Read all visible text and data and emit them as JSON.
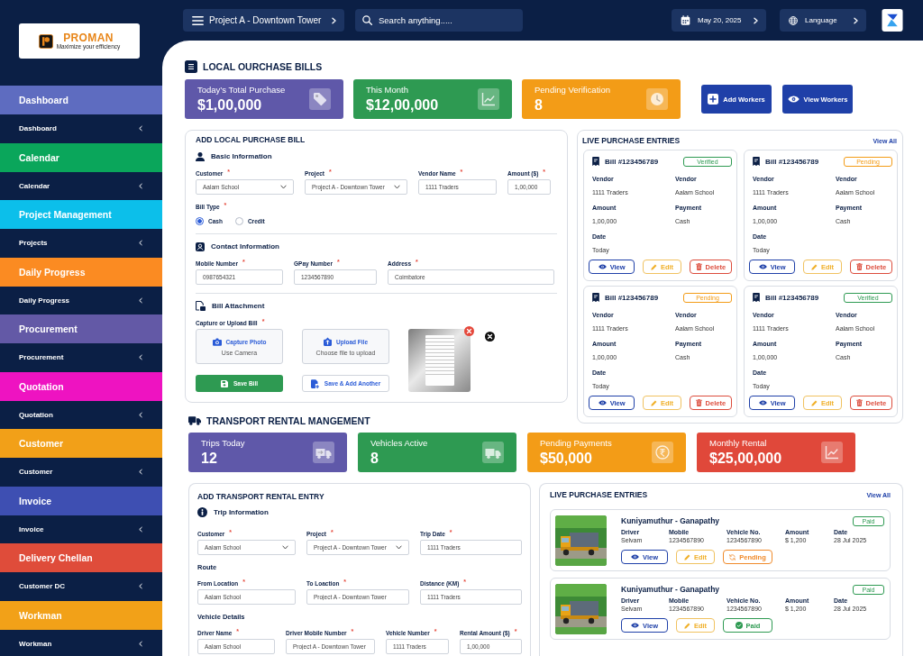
{
  "logo": {
    "name": "PROMAN",
    "tagline": "Maximize your efficiency"
  },
  "topbar": {
    "project": "Project A - Downtown Tower",
    "search": {
      "placeholder": "Search anything....."
    },
    "date": "May 20, 2025",
    "language": "Language"
  },
  "sidebar": {
    "groups": [
      {
        "title": "Dashboard",
        "color": "#5e6cc0",
        "item": "Dashboard"
      },
      {
        "title": "Calendar",
        "color": "#0aa65b",
        "item": "Calendar"
      },
      {
        "title": "Project Management",
        "color": "#0cbfea",
        "item": "Projects"
      },
      {
        "title": "Daily Progress",
        "color": "#fb8b22",
        "item": "Daily Progress"
      },
      {
        "title": "Procurement",
        "color": "#6359a6",
        "item": "Procurement"
      },
      {
        "title": "Quotation",
        "color": "#ee13c1",
        "item": "Quotation"
      },
      {
        "title": "Customer",
        "color": "#f2a018",
        "item": "Customer"
      },
      {
        "title": "Invoice",
        "color": "#3e4fb2",
        "item": "Invoice"
      },
      {
        "title": "Delivery Chellan",
        "color": "#df4c3a",
        "item": "Customer DC"
      },
      {
        "title": "Workman",
        "color": "#f2a118",
        "item": "Workman"
      }
    ]
  },
  "local_purchase": {
    "title": "LOCAL OURCHASE BILLS",
    "stats": [
      {
        "label": "Today’s Total Purchase",
        "value": "$1,00,000",
        "color": "#5f58a9",
        "kind": "tag"
      },
      {
        "label": "This Month",
        "value": "$12,00,000",
        "color": "#2e9a52",
        "kind": "chart"
      },
      {
        "label": "Pending Verification",
        "value": "8",
        "color": "#f39c17",
        "kind": "clock"
      }
    ],
    "actions": [
      {
        "label": "Add Workers",
        "kind": "add"
      },
      {
        "label": "View Workers",
        "kind": "view"
      }
    ],
    "form": {
      "title": "ADD LOCAL PURCHASE BILL",
      "sections": [
        {
          "kind": "basic",
          "title": "Basic Information",
          "fields": [
            {
              "label": "Customer",
              "mark": "*",
              "kind": "select",
              "value": "Aalam School"
            },
            {
              "label": "Project",
              "mark": "*",
              "kind": "select",
              "value": "Project A - Downtown Tower"
            },
            {
              "label": "Vendor Name",
              "mark": "*",
              "kind": "text",
              "value": "1111 Traders"
            },
            {
              "label": "Amount ($)",
              "mark": "*",
              "kind": "text",
              "value": "1,00,000"
            }
          ],
          "choice": {
            "label": "Bill Type",
            "mark": "*",
            "options": [
              {
                "label": "Cash",
                "selected": true
              },
              {
                "label": "Credit",
                "selected": false
              }
            ]
          }
        },
        {
          "kind": "contact",
          "title": "Contact Information",
          "fields": [
            {
              "label": "Mobile Number",
              "mark": "*",
              "kind": "text",
              "value": "0987654321"
            },
            {
              "label": "GPay Number",
              "mark": "*",
              "kind": "text",
              "value": "1234567890"
            },
            {
              "label": "Address",
              "mark": "*",
              "kind": "text",
              "value": "Coimbatore"
            }
          ]
        },
        {
          "kind": "attachment",
          "title": "Bill Attachment",
          "label": "Capture or Upload Bill",
          "mark": "*",
          "attached": true,
          "sources": [
            {
              "kind": "camera",
              "title": "Capture Photo",
              "hint": "Use Camera"
            },
            {
              "kind": "upload",
              "title": "Upload File",
              "hint": "Choose file to upload"
            }
          ],
          "buttons": [
            {
              "kind": "primary",
              "label": "Save Bill"
            },
            {
              "kind": "secondary",
              "label": "Save & Add Another"
            }
          ]
        }
      ]
    },
    "entries": {
      "title": "LIVE PURCHASE ENTRIES",
      "link": "View All",
      "bills": [
        {
          "number": "Bill #123456789",
          "status": {
            "label": "Verified",
            "kind": "verified"
          },
          "fields": [
            {
              "label": "Vendor",
              "value": "1111 Traders"
            },
            {
              "label": "Vendor",
              "value": "Aalam School"
            },
            {
              "label": "Amount",
              "value": "1,00,000"
            },
            {
              "label": "Payment",
              "value": "Cash"
            },
            {
              "label": "Date",
              "value": "Today"
            }
          ],
          "actions": [
            {
              "label": "View",
              "kind": "view"
            },
            {
              "label": "Edit",
              "kind": "edit"
            },
            {
              "label": "Delete",
              "kind": "delete"
            }
          ]
        },
        {
          "number": "Bill #123456789",
          "status": {
            "label": "Pending",
            "kind": "pending"
          },
          "fields": [
            {
              "label": "Vendor",
              "value": "1111 Traders"
            },
            {
              "label": "Vendor",
              "value": "Aalam School"
            },
            {
              "label": "Amount",
              "value": "1,00,000"
            },
            {
              "label": "Payment",
              "value": "Cash"
            },
            {
              "label": "Date",
              "value": "Today"
            }
          ],
          "actions": [
            {
              "label": "View",
              "kind": "view"
            },
            {
              "label": "Edit",
              "kind": "edit"
            },
            {
              "label": "Delete",
              "kind": "delete"
            }
          ]
        },
        {
          "number": "Bill #123456789",
          "status": {
            "label": "Pending",
            "kind": "pending"
          },
          "fields": [
            {
              "label": "Vendor",
              "value": "1111 Traders"
            },
            {
              "label": "Vendor",
              "value": "Aalam School"
            },
            {
              "label": "Amount",
              "value": "1,00,000"
            },
            {
              "label": "Payment",
              "value": "Cash"
            },
            {
              "label": "Date",
              "value": "Today"
            }
          ],
          "actions": [
            {
              "label": "View",
              "kind": "view"
            },
            {
              "label": "Edit",
              "kind": "edit"
            },
            {
              "label": "Delete",
              "kind": "delete"
            }
          ]
        },
        {
          "number": "Bill #123456789",
          "status": {
            "label": "Verified",
            "kind": "verified"
          },
          "fields": [
            {
              "label": "Vendor",
              "value": "1111 Traders"
            },
            {
              "label": "Vendor",
              "value": "Aalam School"
            },
            {
              "label": "Amount",
              "value": "1,00,000"
            },
            {
              "label": "Payment",
              "value": "Cash"
            },
            {
              "label": "Date",
              "value": "Today"
            }
          ],
          "actions": [
            {
              "label": "View",
              "kind": "view"
            },
            {
              "label": "Edit",
              "kind": "edit"
            },
            {
              "label": "Delete",
              "kind": "delete"
            }
          ]
        }
      ]
    }
  },
  "transport": {
    "title": "TRANSPORT RENTAL MANGEMENT",
    "stats": [
      {
        "label": "Trips Today",
        "value": "12",
        "color": "#5f58a9",
        "kind": "truck-arrow"
      },
      {
        "label": "Vehicles Active",
        "value": "8",
        "color": "#2e9a52",
        "kind": "truck"
      },
      {
        "label": "Pending Payments",
        "value": "$50,000",
        "color": "#f39c17",
        "kind": "coin"
      },
      {
        "label": "Monthly Rental",
        "value": "$25,00,000",
        "color": "#e0483a",
        "kind": "chart"
      }
    ],
    "form": {
      "title": "ADD TRANSPORT RENTAL ENTRY",
      "sections": [
        {
          "kind": "info",
          "title": "Trip Information",
          "fields": [
            {
              "label": "Customer",
              "mark": "*",
              "kind": "select",
              "value": "Aalam School"
            },
            {
              "label": "Project",
              "mark": "*",
              "kind": "select",
              "value": "Project A - Downtown Tower"
            },
            {
              "label": "Trip Date",
              "mark": "*",
              "kind": "text",
              "value": "1111 Traders"
            }
          ]
        },
        {
          "kind": "plain",
          "title": "Route",
          "fields": [
            {
              "label": "From Location",
              "mark": "*",
              "kind": "text",
              "value": "Aalam School"
            },
            {
              "label": "To Loaction",
              "mark": "*",
              "kind": "text",
              "value": "Project A - Downtown Tower"
            },
            {
              "label": "Distance (KM)",
              "mark": "*",
              "kind": "text",
              "value": "1111 Traders"
            }
          ]
        },
        {
          "kind": "plain",
          "title": "Vehicle Details",
          "fields": [
            {
              "label": "Driver Name",
              "mark": "*",
              "kind": "text",
              "value": "Aalam School"
            },
            {
              "label": "Driver Mobile Number",
              "mark": "*",
              "kind": "text",
              "value": "Project A - Downtown Tower"
            },
            {
              "label": "Vehicle Number",
              "mark": "*",
              "kind": "text",
              "value": "1111 Traders"
            },
            {
              "label": "Rental Amount ($)",
              "mark": "*",
              "kind": "text",
              "value": "1,00,000"
            }
          ]
        }
      ]
    },
    "entries": {
      "title": "LIVE PURCHASE ENTRIES",
      "link": "View All",
      "trips": [
        {
          "route": "Kuniyamuthur - Ganapathy",
          "status": {
            "label": "Paid",
            "kind": "paid"
          },
          "details": [
            {
              "label": "Driver",
              "value": "Selvam"
            },
            {
              "label": "Mobile",
              "value": "1234567890"
            },
            {
              "label": "Vehicle No.",
              "value": "1234567890"
            },
            {
              "label": "Amount",
              "value": "$ 1,200"
            },
            {
              "label": "Date",
              "value": "28 Jul 2025"
            }
          ],
          "actions": [
            {
              "label": "View",
              "kind": "view"
            },
            {
              "label": "Edit",
              "kind": "edit"
            },
            {
              "label": "Pending",
              "kind": "pending"
            }
          ]
        },
        {
          "route": "Kuniyamuthur - Ganapathy",
          "status": {
            "label": "Paid",
            "kind": "paid"
          },
          "details": [
            {
              "label": "Driver",
              "value": "Selvam"
            },
            {
              "label": "Mobile",
              "value": "1234567890"
            },
            {
              "label": "Vehicle No.",
              "value": "1234567890"
            },
            {
              "label": "Amount",
              "value": "$ 1,200"
            },
            {
              "label": "Date",
              "value": "28 Jul 2025"
            }
          ],
          "actions": [
            {
              "label": "View",
              "kind": "view"
            },
            {
              "label": "Edit",
              "kind": "edit"
            },
            {
              "label": "Paid",
              "kind": "paid"
            }
          ]
        }
      ]
    }
  }
}
